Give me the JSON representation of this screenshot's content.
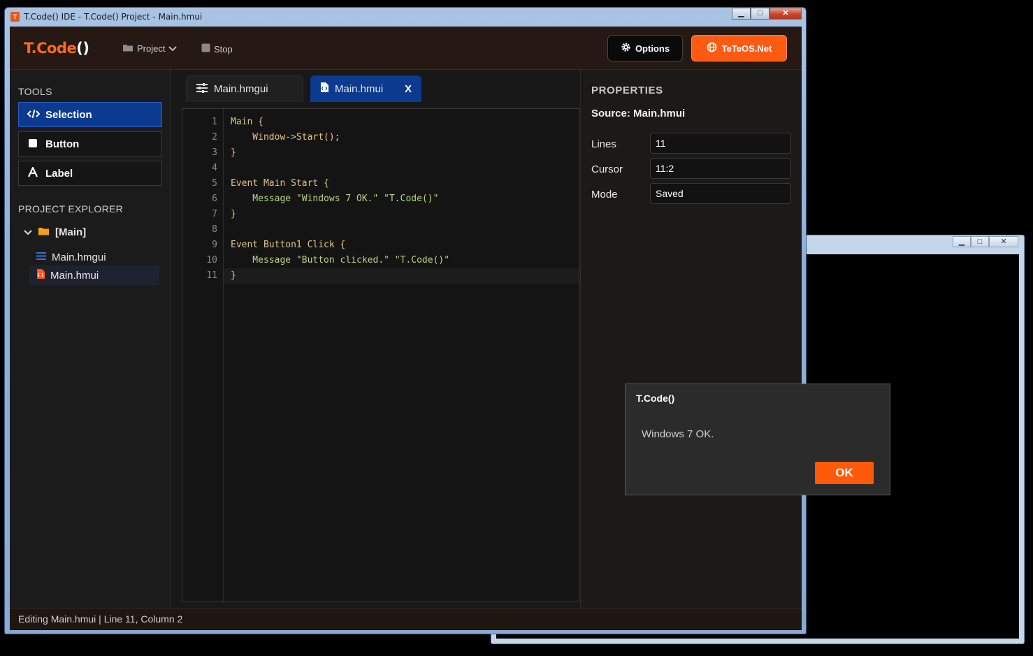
{
  "window": {
    "title": "T.Code() IDE - T.Code() Project - Main.hmui",
    "app_icon_letter": "T",
    "minimize": "▁",
    "maximize": "□",
    "close": "✕"
  },
  "background_window": {
    "minimize": "▁",
    "maximize": "□",
    "close": "✕"
  },
  "header": {
    "logo_text": "T.Code",
    "logo_parens": "()",
    "menu_project": "Project",
    "menu_stop": "Stop",
    "options_label": "Options",
    "teteos_label": "TeTeOS.Net"
  },
  "tools": {
    "heading": "TOOLS",
    "items": [
      {
        "label": "Selection",
        "icon": "code-icon",
        "active": true
      },
      {
        "label": "Button",
        "icon": "square-icon",
        "active": false
      },
      {
        "label": "Label",
        "icon": "letter-a-icon",
        "active": false
      }
    ]
  },
  "explorer": {
    "heading": "PROJECT EXPLORER",
    "root": "[Main]",
    "files": [
      "Main.hmgui",
      "Main.hmui"
    ],
    "selected": "Main.hmui"
  },
  "tabs": [
    {
      "label": "Main.hmgui",
      "active": false
    },
    {
      "label": "Main.hmui",
      "active": true,
      "close": "X"
    }
  ],
  "editor": {
    "line_numbers": [
      "1",
      "2",
      "3",
      "4",
      "5",
      "6",
      "7",
      "8",
      "9",
      "10",
      "11"
    ],
    "lines": [
      "Main {",
      "    Window->Start();",
      "}",
      "",
      "Event Main Start {",
      "    Message \"Windows 7 OK.\" \"T.Code()\"",
      "}",
      "",
      "Event Button1 Click {",
      "    Message \"Button clicked.\" \"T.Code()\"",
      "}"
    ]
  },
  "properties": {
    "heading": "PROPERTIES",
    "source": "Source: Main.hmui",
    "fields": [
      {
        "label": "Lines",
        "value": "11"
      },
      {
        "label": "Cursor",
        "value": "11:2"
      },
      {
        "label": "Mode",
        "value": "Saved"
      }
    ]
  },
  "status_bar": "Editing Main.hmui | Line 11, Column 2",
  "dialog": {
    "title": "T.Code()",
    "message": "Windows 7 OK.",
    "ok_label": "OK"
  },
  "colors": {
    "accent": "#ff5a12",
    "active_blue": "#0b3a8f",
    "header_bg": "#261812"
  }
}
